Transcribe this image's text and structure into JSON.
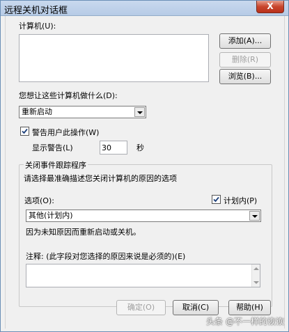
{
  "window": {
    "title": "远程关机对话框",
    "close_label": "X"
  },
  "computers": {
    "label": "计算机(U):",
    "add_label": "添加(A)...",
    "remove_label": "删除(R)",
    "browse_label": "浏览(B)..."
  },
  "action": {
    "label": "您想让这些计算机做什么(D):",
    "selected": "重新启动"
  },
  "warn": {
    "checkbox_label": "警告用户此操作(W)",
    "checked": true,
    "display_label": "显示警告(L)",
    "seconds_value": "30",
    "seconds_unit": "秒"
  },
  "tracker": {
    "group_title": "关闭事件跟踪程序",
    "description": "请选择最准确描述您关闭计算机的原因的选项",
    "options_label": "选项(O):",
    "planned_label": "计划内(P)",
    "planned_checked": true,
    "selected_option": "其他(计划内)",
    "reason_text": "因为未知原因而重新启动或关机。",
    "comment_label": "注释: (此字段对您选择的原因来说是必须的)(E)",
    "comment_value": ""
  },
  "footer": {
    "ok_label": "确定(O)",
    "cancel_label": "取消(C)",
    "help_label": "帮助(H)"
  },
  "watermark": "头条 @不一样的诙诙"
}
